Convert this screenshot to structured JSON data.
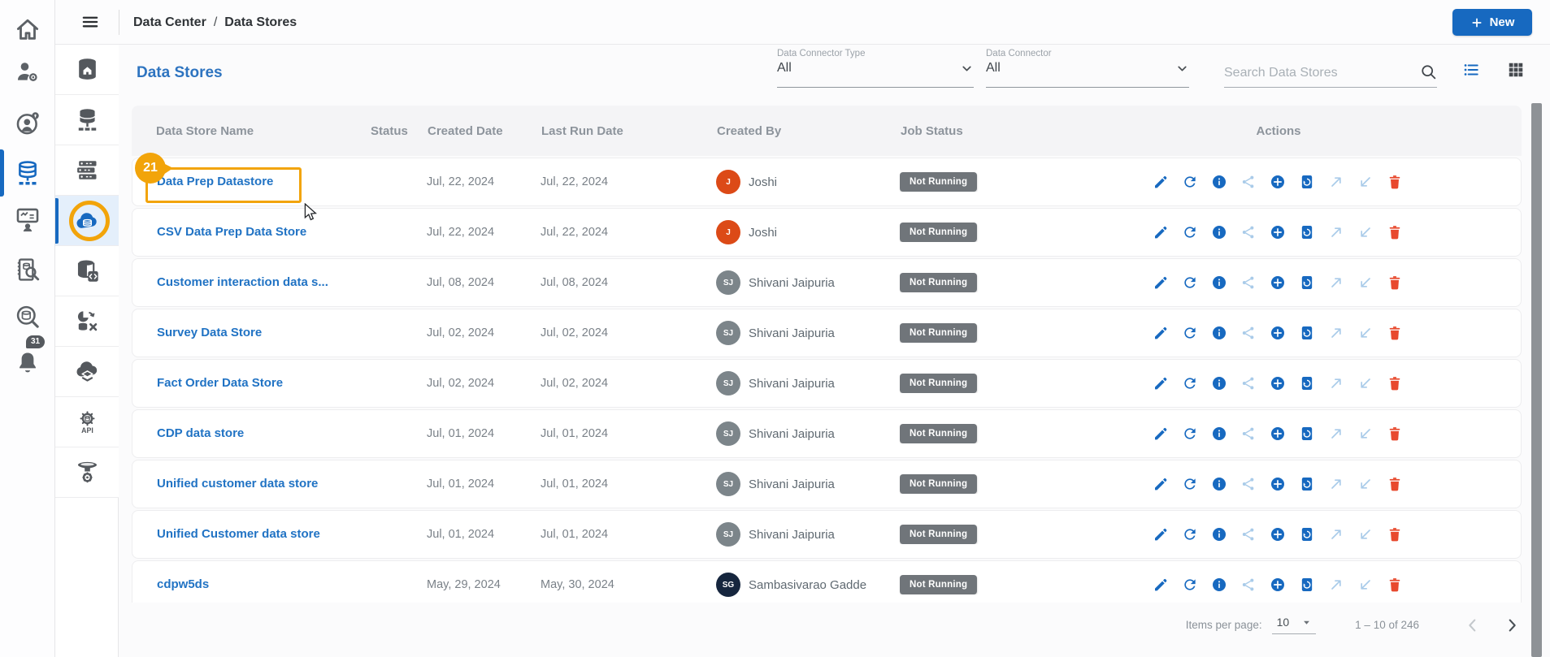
{
  "topbar": {
    "breadcrumb": {
      "items": [
        "Data Center",
        "Data Stores"
      ],
      "separator": "/"
    },
    "new_button_label": "New"
  },
  "primary_sidebar": {
    "items": [
      {
        "label": "home",
        "icon": "home"
      },
      {
        "label": "user-settings",
        "icon": "user-gear"
      },
      {
        "label": "user-security",
        "icon": "user-shield"
      },
      {
        "label": "data-sources",
        "icon": "database",
        "active": true
      },
      {
        "label": "training",
        "icon": "presentation"
      },
      {
        "label": "audit-logs",
        "icon": "audit"
      },
      {
        "label": "data-search",
        "icon": "search-db"
      },
      {
        "label": "notifications",
        "icon": "bell",
        "badge": "31"
      }
    ]
  },
  "secondary_sidebar": {
    "items": [
      {
        "label": "data-center-home",
        "icon": "db-home"
      },
      {
        "label": "data-connections",
        "icon": "db-net"
      },
      {
        "label": "data-servers",
        "icon": "servers"
      },
      {
        "label": "cloud-data-stores",
        "icon": "cloud-db",
        "active": true
      },
      {
        "label": "data-store-scripts",
        "icon": "db-code"
      },
      {
        "label": "data-transform",
        "icon": "transform"
      },
      {
        "label": "cloud-layers",
        "icon": "cloud-layers"
      },
      {
        "label": "api-services",
        "icon": "api"
      },
      {
        "label": "data-funnel",
        "icon": "funnel"
      }
    ]
  },
  "page": {
    "title": "Data Stores",
    "filters": [
      {
        "label": "Data Connector Type",
        "value": "All"
      },
      {
        "label": "Data Connector",
        "value": "All"
      }
    ],
    "search_placeholder": "Search Data Stores"
  },
  "table": {
    "columns": [
      "Data Store Name",
      "Status",
      "Created Date",
      "Last Run Date",
      "Created By",
      "Job Status",
      "Actions"
    ],
    "action_icons": [
      {
        "name": "edit",
        "tone": "solid"
      },
      {
        "name": "refresh",
        "tone": "solid"
      },
      {
        "name": "info",
        "tone": "solid"
      },
      {
        "name": "share",
        "tone": "light"
      },
      {
        "name": "add",
        "tone": "solid"
      },
      {
        "name": "restore",
        "tone": "solid"
      },
      {
        "name": "export",
        "tone": "light"
      },
      {
        "name": "import",
        "tone": "light"
      },
      {
        "name": "delete",
        "tone": "danger"
      }
    ],
    "rows": [
      {
        "name": "Data Prep Datastore",
        "status": "",
        "created": "Jul, 22, 2024",
        "last_run": "Jul, 22, 2024",
        "creator_initials": "J",
        "creator_name": "Joshi",
        "avatar_color": "#DC4A17",
        "job_status": "Not Running"
      },
      {
        "name": "CSV Data Prep Data Store",
        "status": "",
        "created": "Jul, 22, 2024",
        "last_run": "Jul, 22, 2024",
        "creator_initials": "J",
        "creator_name": "Joshi",
        "avatar_color": "#DC4A17",
        "job_status": "Not Running"
      },
      {
        "name": "Customer interaction data s...",
        "status": "",
        "created": "Jul, 08, 2024",
        "last_run": "Jul, 08, 2024",
        "creator_initials": "SJ",
        "creator_name": "Shivani Jaipuria",
        "avatar_color": "#7C858A",
        "job_status": "Not Running"
      },
      {
        "name": "Survey Data Store",
        "status": "",
        "created": "Jul, 02, 2024",
        "last_run": "Jul, 02, 2024",
        "creator_initials": "SJ",
        "creator_name": "Shivani Jaipuria",
        "avatar_color": "#7C858A",
        "job_status": "Not Running"
      },
      {
        "name": "Fact Order Data Store",
        "status": "",
        "created": "Jul, 02, 2024",
        "last_run": "Jul, 02, 2024",
        "creator_initials": "SJ",
        "creator_name": "Shivani Jaipuria",
        "avatar_color": "#7C858A",
        "job_status": "Not Running"
      },
      {
        "name": "CDP data store",
        "status": "",
        "created": "Jul, 01, 2024",
        "last_run": "Jul, 01, 2024",
        "creator_initials": "SJ",
        "creator_name": "Shivani Jaipuria",
        "avatar_color": "#7C858A",
        "job_status": "Not Running"
      },
      {
        "name": "Unified customer data store",
        "status": "",
        "created": "Jul, 01, 2024",
        "last_run": "Jul, 01, 2024",
        "creator_initials": "SJ",
        "creator_name": "Shivani Jaipuria",
        "avatar_color": "#7C858A",
        "job_status": "Not Running"
      },
      {
        "name": "Unified Customer data store",
        "status": "",
        "created": "Jul, 01, 2024",
        "last_run": "Jul, 01, 2024",
        "creator_initials": "SJ",
        "creator_name": "Shivani Jaipuria",
        "avatar_color": "#7C858A",
        "job_status": "Not Running"
      },
      {
        "name": "cdpw5ds",
        "status": "",
        "created": "May, 29, 2024",
        "last_run": "May, 30, 2024",
        "creator_initials": "SG",
        "creator_name": "Sambasivarao Gadde",
        "avatar_color": "#16263E",
        "job_status": "Not Running"
      }
    ]
  },
  "pagination": {
    "items_per_page_label": "Items per page:",
    "items_per_page_value": "10",
    "range": "1 – 10 of 246"
  },
  "annotation": {
    "badge": "21"
  },
  "colors": {
    "accent_blue": "#1769C0",
    "link_blue": "#2173C4",
    "annotation_orange": "#F2A40A",
    "badge_gray": "#70757A",
    "delete_red": "#E8492E",
    "light_action_blue": "#A9CBE9"
  }
}
